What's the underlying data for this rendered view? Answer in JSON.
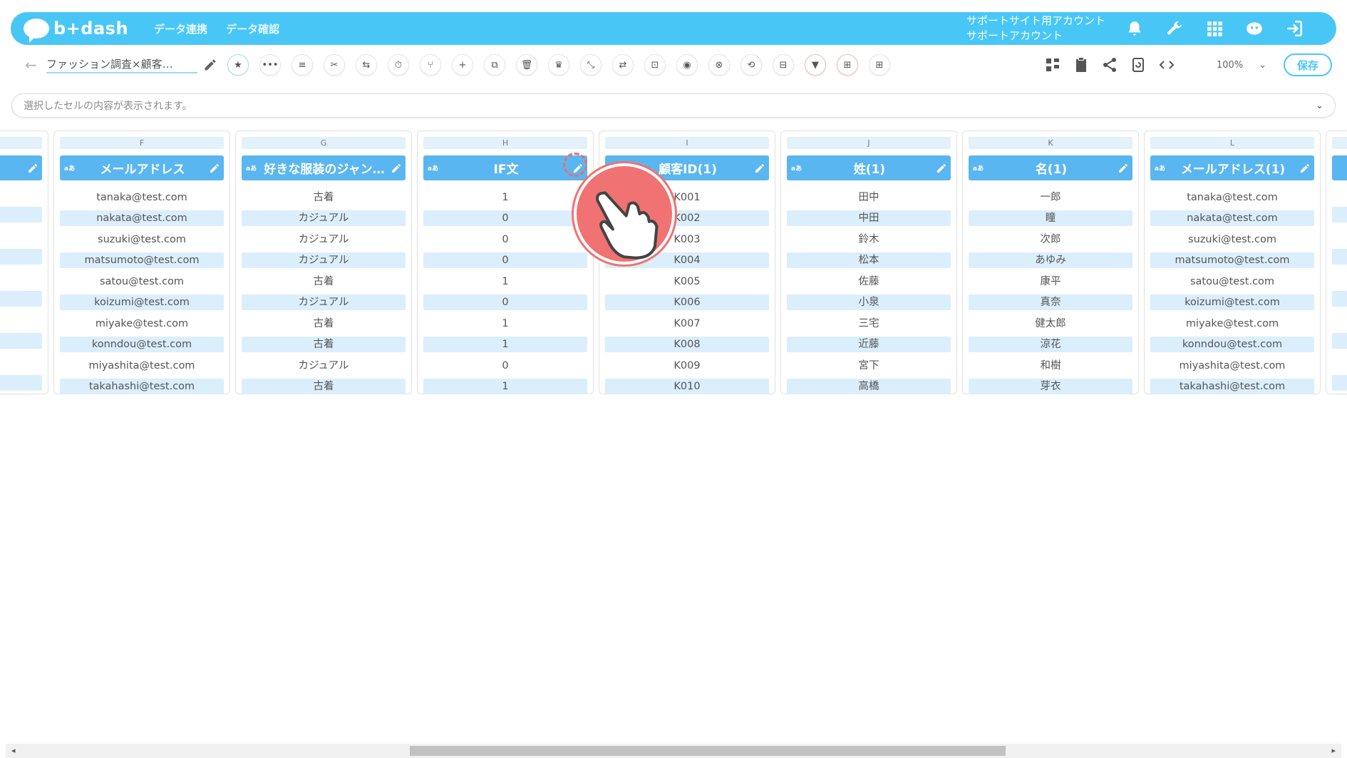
{
  "header": {
    "logo_text": "b+dash",
    "nav": [
      "データ連携",
      "データ確認"
    ],
    "account_line1": "サポートサイト用アカウント",
    "account_line2": "サポートアカウント",
    "icons": [
      "bell-icon",
      "wrench-icon",
      "apps-grid-icon",
      "chat-bot-icon",
      "logout-icon"
    ],
    "accent_color": "#48c7f7"
  },
  "toolbar": {
    "back_icon": "←",
    "file_name": "ファッション調査×顧客…",
    "tools": [
      "★",
      "•••",
      "≡",
      "✂",
      "⇆",
      "⏱",
      "⑂",
      "+",
      "⧉",
      "🗑",
      "♛",
      "⤡",
      "⇄",
      "⊡",
      "◉",
      "⊗",
      "⟲",
      "⊟",
      "▼",
      "⊞",
      "⊞"
    ],
    "zoom": "100%",
    "save_label": "保存"
  },
  "cellbar": {
    "placeholder": "選択したセルの内容が表示されます。"
  },
  "columns": [
    {
      "letter": "F",
      "type": "aあ",
      "title": "メールアドレス",
      "cells": [
        "tanaka@test.com",
        "nakata@test.com",
        "suzuki@test.com",
        "matsumoto@test.com",
        "satou@test.com",
        "koizumi@test.com",
        "miyake@test.com",
        "konndou@test.com",
        "miyashita@test.com",
        "takahashi@test.com"
      ]
    },
    {
      "letter": "G",
      "type": "aあ",
      "title": "好きな服装のジャン…",
      "cells": [
        "古着",
        "カジュアル",
        "カジュアル",
        "カジュアル",
        "古着",
        "カジュアル",
        "古着",
        "古着",
        "カジュアル",
        "古着"
      ]
    },
    {
      "letter": "H",
      "type": "aあ",
      "title": "IF文",
      "cells": [
        "1",
        "0",
        "0",
        "0",
        "1",
        "0",
        "1",
        "1",
        "0",
        "1"
      ]
    },
    {
      "letter": "I",
      "type": "",
      "title": "顧客ID(1)",
      "cells": [
        "K001",
        "K002",
        "K003",
        "K004",
        "K005",
        "K006",
        "K007",
        "K008",
        "K009",
        "K010"
      ]
    },
    {
      "letter": "J",
      "type": "aあ",
      "title": "姓(1)",
      "cells": [
        "田中",
        "中田",
        "鈴木",
        "松本",
        "佐藤",
        "小泉",
        "三宅",
        "近藤",
        "宮下",
        "高橋"
      ]
    },
    {
      "letter": "K",
      "type": "aあ",
      "title": "名(1)",
      "cells": [
        "一郎",
        "瞳",
        "次郎",
        "あゆみ",
        "康平",
        "真奈",
        "健太郎",
        "涼花",
        "和樹",
        "芽衣"
      ]
    },
    {
      "letter": "L",
      "type": "aあ",
      "title": "メールアドレス(1)",
      "cells": [
        "tanaka@test.com",
        "nakata@test.com",
        "suzuki@test.com",
        "matsumoto@test.com",
        "satou@test.com",
        "koizumi@test.com",
        "miyake@test.com",
        "konndou@test.com",
        "miyashita@test.com",
        "takahashi@test.com"
      ]
    }
  ]
}
